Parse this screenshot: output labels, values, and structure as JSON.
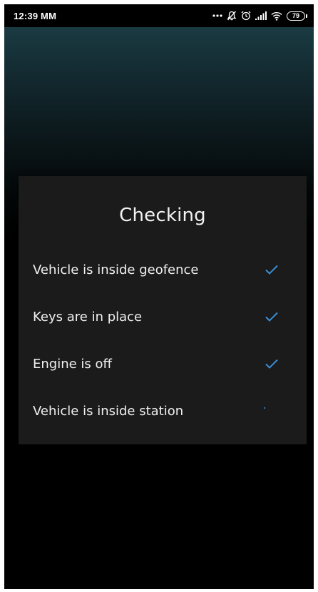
{
  "status_bar": {
    "time": "12:39 MM",
    "battery_level": "79",
    "icons": [
      "more-dots-icon",
      "mute-notifications-icon",
      "alarm-icon",
      "signal-icon",
      "wifi-icon",
      "battery-icon"
    ]
  },
  "dialog": {
    "title": "Checking",
    "items": [
      {
        "label": "Vehicle is inside geofence",
        "status": "done",
        "icon": "checkmark-icon"
      },
      {
        "label": "Keys are in place",
        "status": "done",
        "icon": "checkmark-icon"
      },
      {
        "label": "Engine is off",
        "status": "done",
        "icon": "checkmark-icon"
      },
      {
        "label": "Vehicle is inside station",
        "status": "in-progress",
        "icon": "loading-icon"
      }
    ]
  },
  "colors": {
    "accent": "#3a8fd6",
    "dialog_bg": "#1b1b1b",
    "text": "#f0f0f0",
    "backdrop_top": "#1a3a42"
  }
}
